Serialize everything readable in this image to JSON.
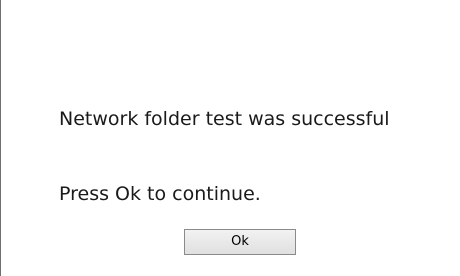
{
  "dialog": {
    "message_line_1": "Network folder test was successful",
    "message_line_2": "Press Ok to continue.",
    "ok_label": "Ok"
  }
}
